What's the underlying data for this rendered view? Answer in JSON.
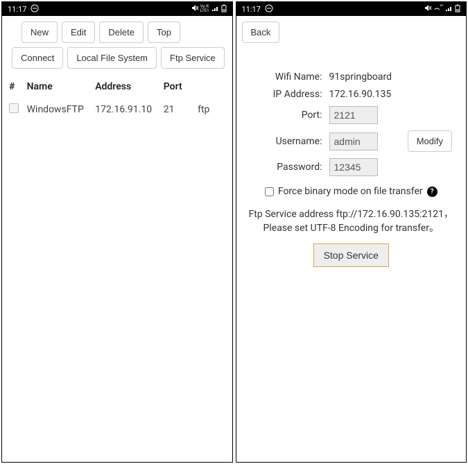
{
  "status": {
    "time": "11:17",
    "indicators": "VoLTE"
  },
  "left": {
    "buttons": {
      "new": "New",
      "edit": "Edit",
      "delete": "Delete",
      "top": "Top",
      "connect": "Connect",
      "localfs": "Local File System",
      "ftpservice": "Ftp Service"
    },
    "table": {
      "headers": {
        "idx": "#",
        "name": "Name",
        "address": "Address",
        "port": "Port"
      },
      "rows": [
        {
          "name": "WindowsFTP",
          "address": "172.16.91.10",
          "port": "21",
          "type": "ftp"
        }
      ]
    }
  },
  "right": {
    "back": "Back",
    "labels": {
      "wifi": "Wifi Name:",
      "ip": "IP Address:",
      "port": "Port:",
      "username": "Username:",
      "password": "Password:"
    },
    "values": {
      "wifi": "91springboard",
      "ip": "172.16.90.135",
      "port": "2121",
      "username": "admin",
      "password": "12345"
    },
    "modify": "Modify",
    "binary_label": "Force binary mode on file transfer",
    "info_line1": "Ftp Service address ftp://172.16.90.135:2121，",
    "info_line2": "Please set UTF-8 Encoding for transfer。",
    "stop": "Stop Service"
  }
}
